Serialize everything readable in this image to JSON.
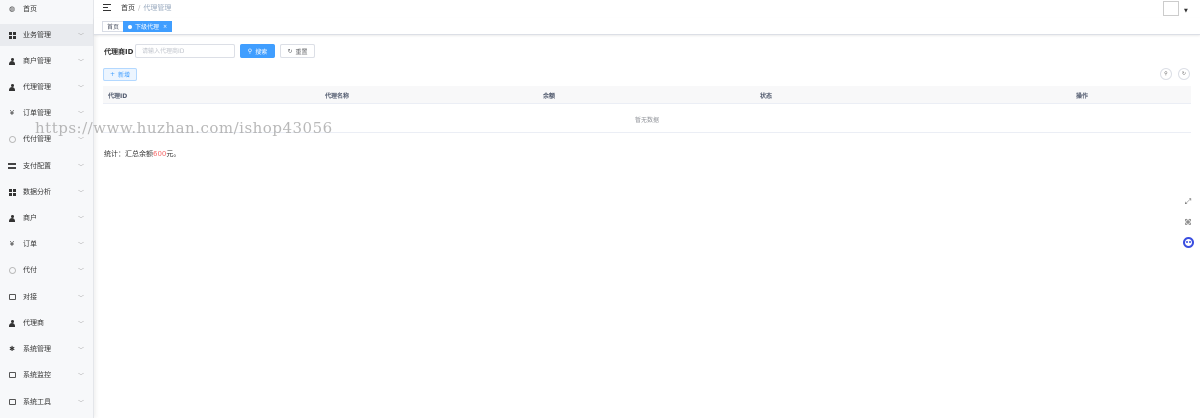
{
  "sidebar": {
    "items": [
      {
        "label": "首页",
        "icon": "dashboard-icon",
        "has_children": false
      },
      {
        "label": "业务管理",
        "icon": "grid-icon",
        "has_children": true,
        "active": true
      },
      {
        "label": "商户管理",
        "icon": "user-group-icon",
        "has_children": true
      },
      {
        "label": "代理管理",
        "icon": "user-icon",
        "has_children": true
      },
      {
        "label": "订单管理",
        "icon": "yen-icon",
        "has_children": true
      },
      {
        "label": "代付管理",
        "icon": "circle-icon",
        "has_children": true
      },
      {
        "label": "支付配置",
        "icon": "layers-icon",
        "has_children": true
      },
      {
        "label": "数据分析",
        "icon": "grid-icon",
        "has_children": true
      },
      {
        "label": "商户",
        "icon": "user-group-icon",
        "has_children": true
      },
      {
        "label": "订单",
        "icon": "yen-icon",
        "has_children": true
      },
      {
        "label": "代付",
        "icon": "circle-icon",
        "has_children": true
      },
      {
        "label": "对接",
        "icon": "briefcase-icon",
        "has_children": true
      },
      {
        "label": "代理商",
        "icon": "user-group-icon",
        "has_children": true
      },
      {
        "label": "系统管理",
        "icon": "gear-icon",
        "has_children": true
      },
      {
        "label": "系统监控",
        "icon": "monitor-icon",
        "has_children": true
      },
      {
        "label": "系统工具",
        "icon": "briefcase-icon",
        "has_children": true
      }
    ]
  },
  "header": {
    "breadcrumb_home": "首页",
    "breadcrumb_sep": "/",
    "breadcrumb_current": "代理管理"
  },
  "tags": {
    "home": "首页",
    "active": "下级代理",
    "close": "×"
  },
  "search": {
    "label": "代理商ID",
    "placeholder": "请输入代理商ID",
    "value": "",
    "search_button": "搜索",
    "reset_button": "重置"
  },
  "toolbar": {
    "add_button": "新增"
  },
  "table": {
    "columns": [
      "代理ID",
      "代理名称",
      "余额",
      "状态",
      "操作"
    ],
    "rows": [],
    "empty_text": "暂无数据"
  },
  "summary": {
    "prefix": "统计：汇总余额",
    "amount": "600",
    "suffix": "元。"
  },
  "watermark": "https://www.huzhan.com/ishop43056",
  "colors": {
    "primary": "#409eff",
    "amount": "#f56c6c",
    "sidebar_bg": "#f7f8fa"
  }
}
